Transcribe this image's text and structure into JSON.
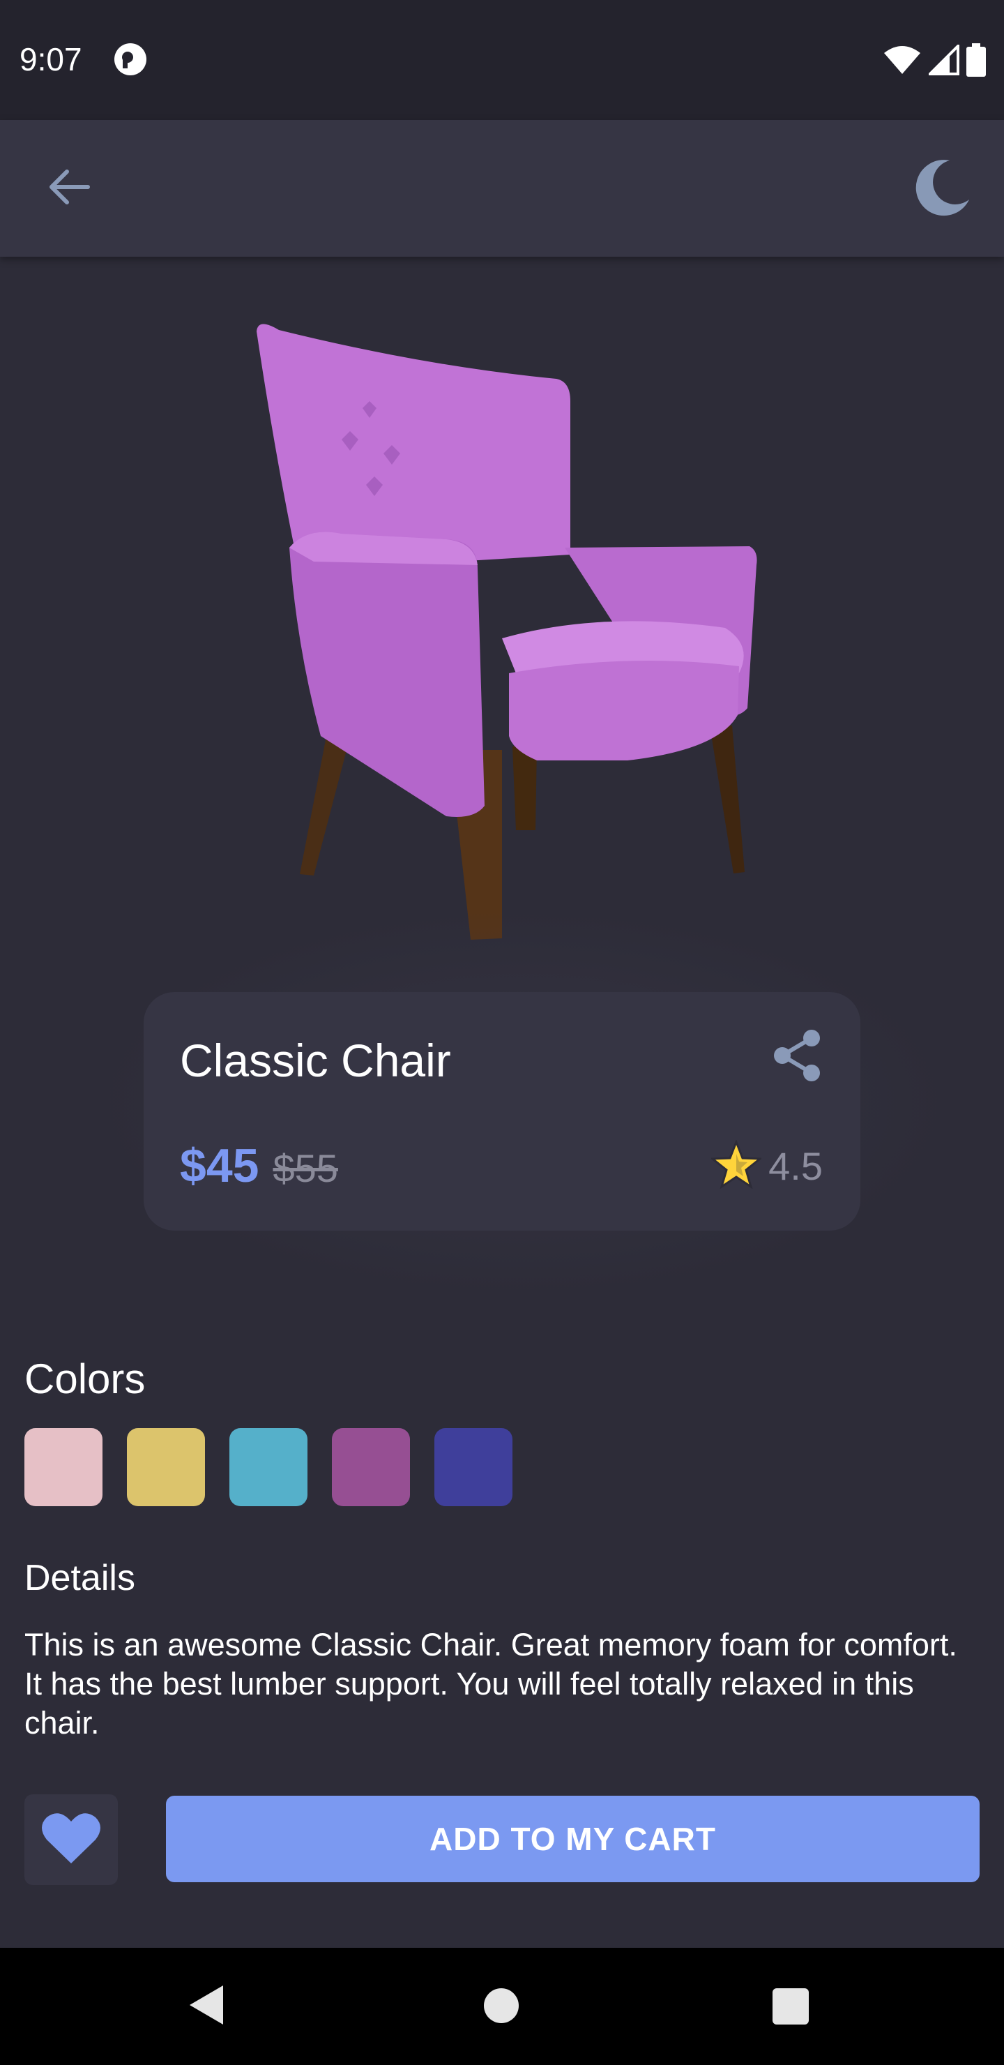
{
  "status_bar": {
    "time": "9:07",
    "icons": [
      "app-notification-icon",
      "wifi-icon",
      "cellular-signal-icon",
      "battery-icon"
    ]
  },
  "app_bar": {
    "back_icon": "arrow-left-icon",
    "theme_icon": "moon-icon"
  },
  "product": {
    "name": "Classic Chair",
    "price": "$45",
    "old_price": "$55",
    "rating": "4.5",
    "share_icon": "share-icon",
    "rating_icon": "star-icon"
  },
  "colors": {
    "title": "Colors",
    "swatches": [
      "#e6c0c6",
      "#dcc46c",
      "#55b0ca",
      "#964f93",
      "#3f3f9b"
    ]
  },
  "details": {
    "title": "Details",
    "text": "This is an awesome Classic Chair. Great memory foam for comfort. It has the best lumber support. You will feel totally relaxed in this chair."
  },
  "actions": {
    "favorite_icon": "heart-icon",
    "add_to_cart_label": "ADD TO MY CART"
  },
  "theme": {
    "background": "#2d2c38",
    "surface": "#363544",
    "accent": "#7b99f1",
    "star": "#ffd43b"
  }
}
